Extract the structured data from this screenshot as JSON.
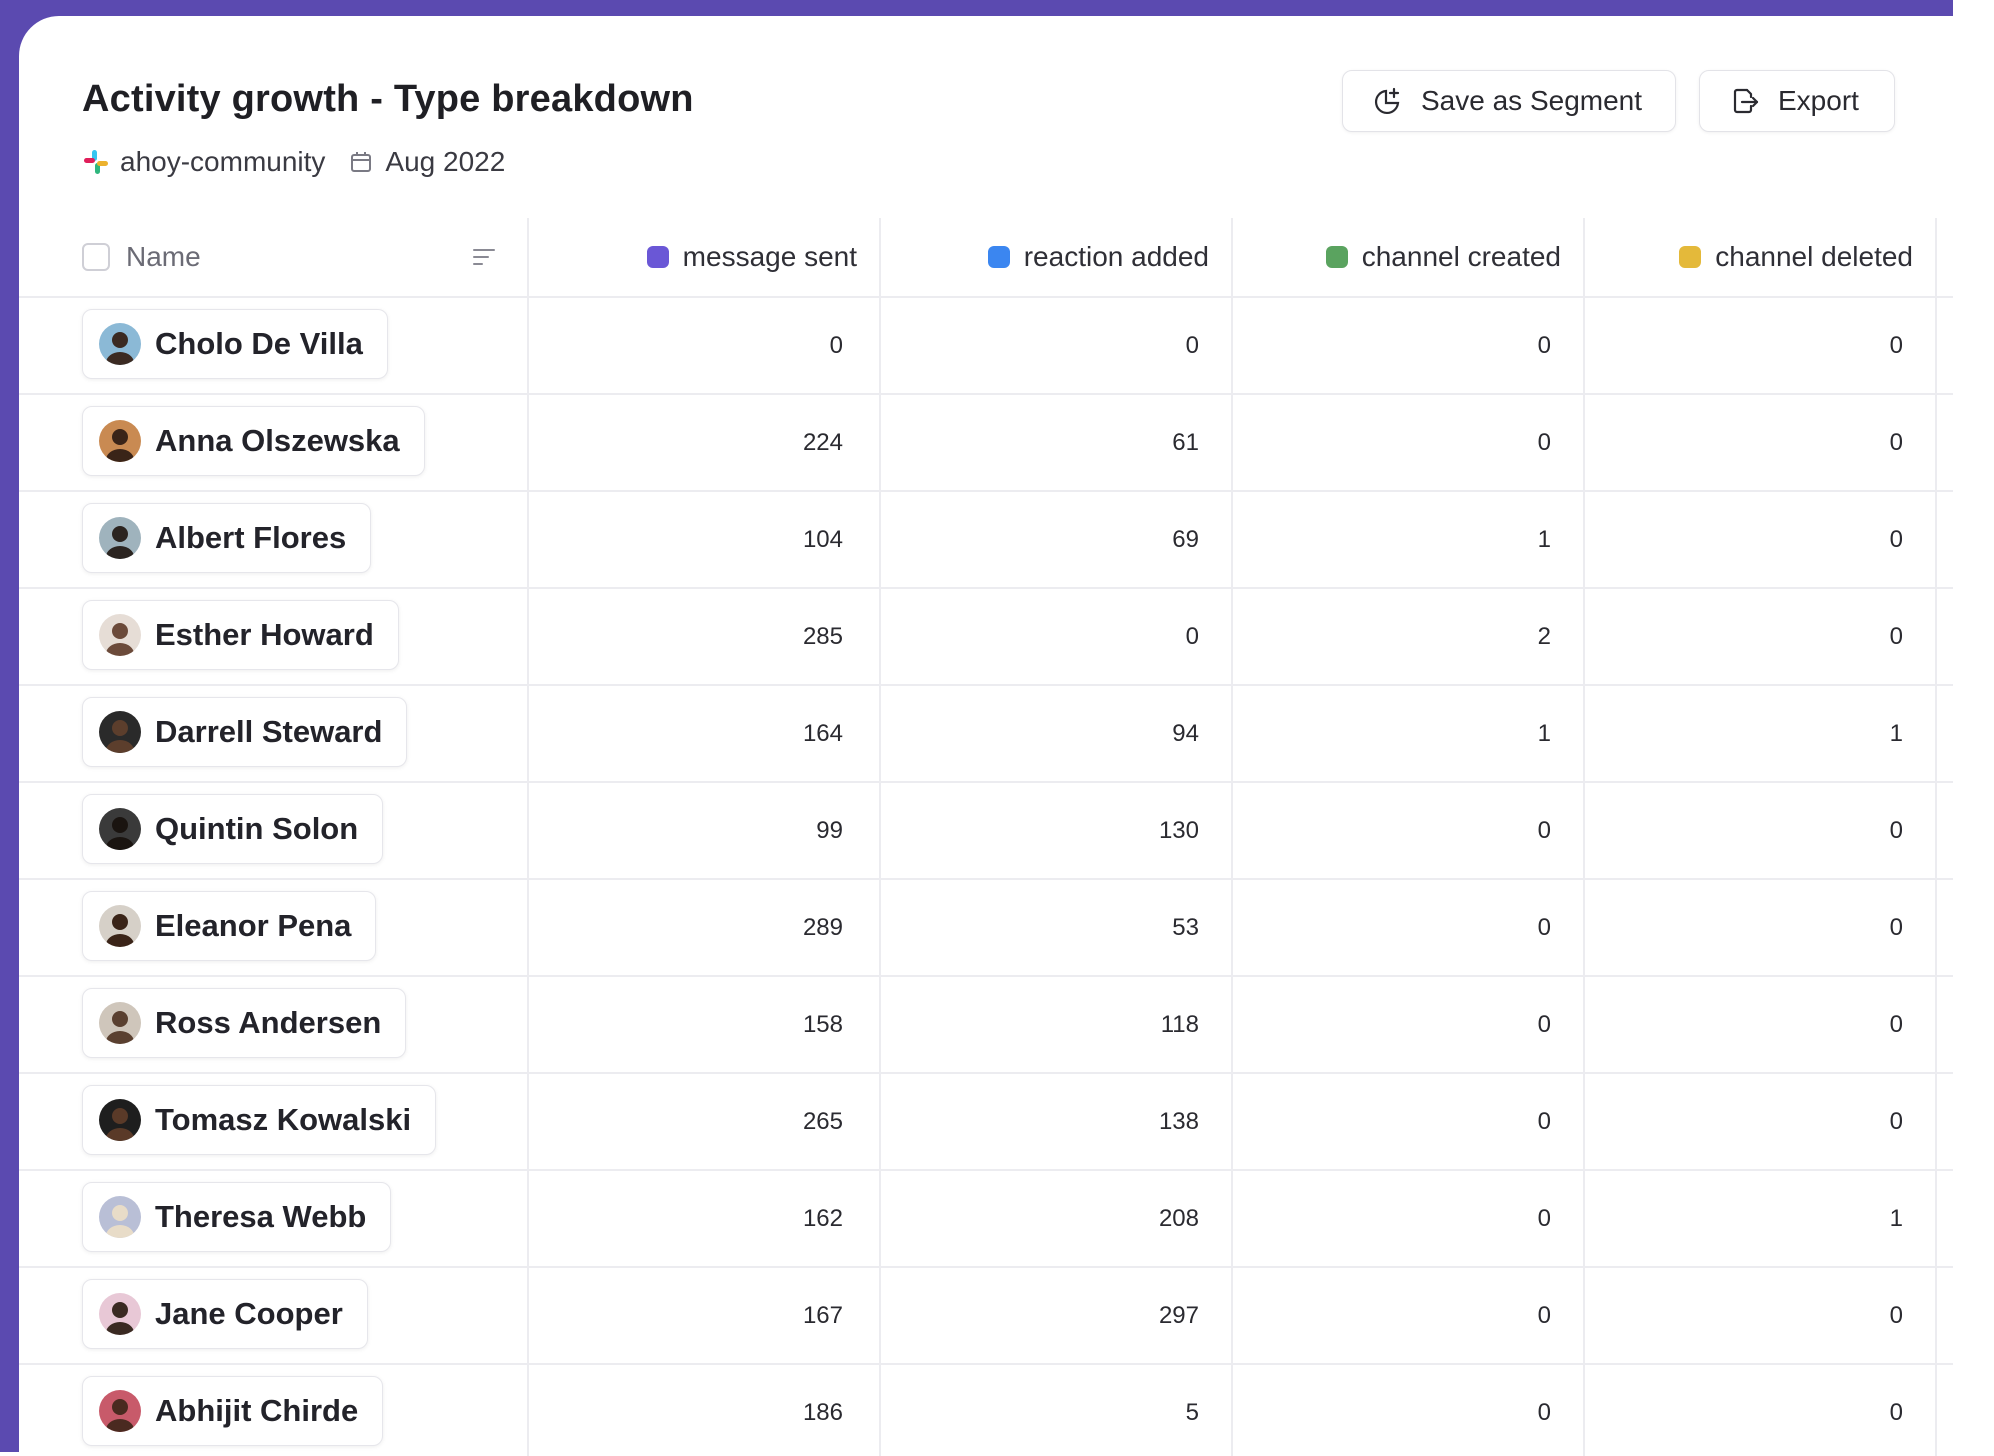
{
  "header": {
    "title": "Activity growth - Type breakdown",
    "workspace": "ahoy-community",
    "date": "Aug 2022",
    "workspace_icon": "slack-icon",
    "date_icon": "calendar-icon"
  },
  "actions": {
    "save_segment": "Save as Segment",
    "export": "Export"
  },
  "table": {
    "name_header": "Name",
    "columns": [
      {
        "label": "message sent",
        "color": "#6a57d6"
      },
      {
        "label": "reaction added",
        "color": "#3b86f0"
      },
      {
        "label": "channel created",
        "color": "#5aa35f"
      },
      {
        "label": "channel deleted",
        "color": "#e4b93a"
      }
    ],
    "rows": [
      {
        "name": "Cholo De Villa",
        "values": [
          "0",
          "0",
          "0",
          "0"
        ]
      },
      {
        "name": "Anna Olszewska",
        "values": [
          "224",
          "61",
          "0",
          "0"
        ]
      },
      {
        "name": "Albert Flores",
        "values": [
          "104",
          "69",
          "1",
          "0"
        ]
      },
      {
        "name": "Esther Howard",
        "values": [
          "285",
          "0",
          "2",
          "0"
        ]
      },
      {
        "name": "Darrell Steward",
        "values": [
          "164",
          "94",
          "1",
          "1"
        ]
      },
      {
        "name": "Quintin Solon",
        "values": [
          "99",
          "130",
          "0",
          "0"
        ]
      },
      {
        "name": "Eleanor Pena",
        "values": [
          "289",
          "53",
          "0",
          "0"
        ]
      },
      {
        "name": "Ross Andersen",
        "values": [
          "158",
          "118",
          "0",
          "0"
        ]
      },
      {
        "name": "Tomasz Kowalski",
        "values": [
          "265",
          "138",
          "0",
          "0"
        ]
      },
      {
        "name": "Theresa Webb",
        "values": [
          "162",
          "208",
          "0",
          "1"
        ]
      },
      {
        "name": "Jane Cooper",
        "values": [
          "167",
          "297",
          "0",
          "0"
        ]
      },
      {
        "name": "Abhijit Chirde",
        "values": [
          "186",
          "5",
          "0",
          "0"
        ]
      }
    ]
  }
}
